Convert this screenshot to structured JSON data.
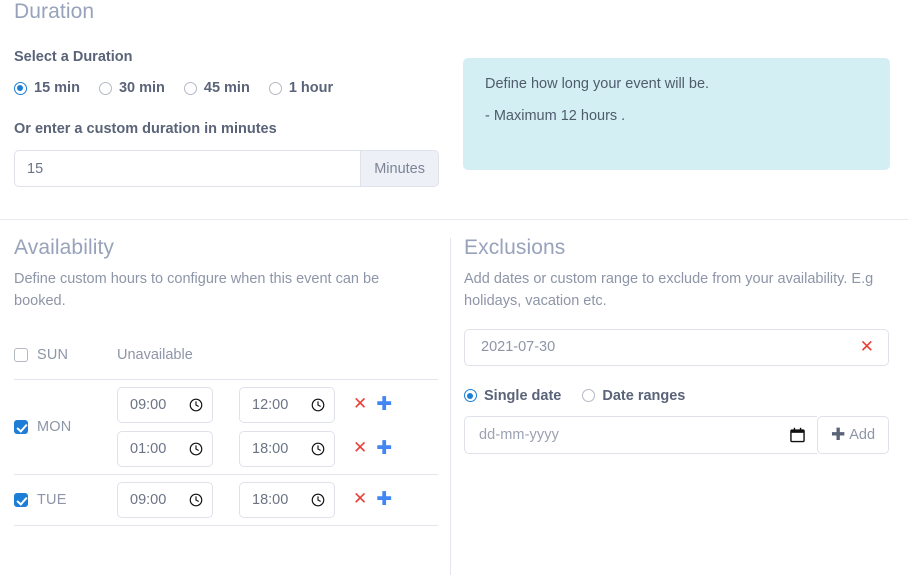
{
  "duration": {
    "heading": "Duration",
    "select_label": "Select a Duration",
    "options": [
      {
        "label": "15 min",
        "selected": true
      },
      {
        "label": "30 min",
        "selected": false
      },
      {
        "label": "45 min",
        "selected": false
      },
      {
        "label": "1 hour",
        "selected": false
      }
    ],
    "custom_label": "Or enter a custom duration in minutes",
    "custom_value": "15",
    "custom_placeholder": "",
    "unit_addon": "Minutes"
  },
  "callout": {
    "line1": "Define how long your event will be.",
    "line2": "- Maximum 12 hours .",
    "background": "#d4eff4"
  },
  "availability": {
    "heading": "Availability",
    "description": "Define custom hours to configure when this event can be booked.",
    "days": [
      {
        "name": "SUN",
        "checked": false,
        "status": "Unavailable",
        "slots": []
      },
      {
        "name": "MON",
        "checked": true,
        "status": "",
        "slots": [
          {
            "from": "09:00",
            "to": "12:00"
          },
          {
            "from": "01:00",
            "to": "18:00"
          }
        ]
      },
      {
        "name": "TUE",
        "checked": true,
        "status": "",
        "slots": [
          {
            "from": "09:00",
            "to": "18:00"
          }
        ]
      }
    ],
    "remove_icon": "close-x-icon",
    "add_icon": "plus-icon",
    "time_icon": "clock-icon"
  },
  "exclusions": {
    "heading": "Exclusions",
    "description": "Add dates or custom range to exclude from your availability. E.g holidays, vacation etc.",
    "items": [
      {
        "date": "2021-07-30",
        "remove_icon": "close-x-icon"
      }
    ],
    "mode_options": [
      {
        "label": "Single date",
        "selected": true
      },
      {
        "label": "Date ranges",
        "selected": false
      }
    ],
    "date_placeholder": "dd-mm-yyyy",
    "date_value": "",
    "calendar_icon": "calendar-icon",
    "add_button_label": "Add",
    "add_button_icon": "plus-icon"
  },
  "colors": {
    "accent_blue": "#1c7ed6",
    "plus_blue": "#4285f4",
    "danger_red": "#e8413a",
    "heading_gray": "#98a2bb",
    "label_gray": "#5a6378",
    "muted_gray": "#8d95a8",
    "border_gray": "#dfe2ea",
    "callout_bg": "#d4eff4"
  }
}
